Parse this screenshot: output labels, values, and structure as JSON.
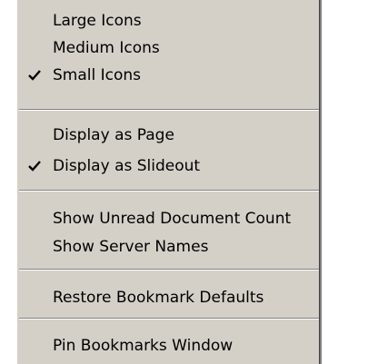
{
  "menu": {
    "groups": [
      {
        "items": [
          {
            "label": "Large Icons",
            "checked": false
          },
          {
            "label": "Medium Icons",
            "checked": false
          },
          {
            "label": "Small Icons",
            "checked": true
          }
        ]
      },
      {
        "items": [
          {
            "label": "Display as Page",
            "checked": false
          },
          {
            "label": "Display as Slideout",
            "checked": true
          }
        ]
      },
      {
        "items": [
          {
            "label": "Show Unread Document Count",
            "checked": false
          },
          {
            "label": "Show Server Names",
            "checked": false
          }
        ]
      },
      {
        "items": [
          {
            "label": "Restore Bookmark Defaults",
            "checked": false
          }
        ]
      },
      {
        "items": [
          {
            "label": "Pin Bookmarks Window",
            "checked": false
          }
        ]
      }
    ]
  },
  "colors": {
    "menu_background": "#d4d0c8",
    "text": "#000000",
    "separator_dark": "#808080",
    "separator_light": "#ffffff"
  },
  "icons": {
    "check": "check-icon"
  }
}
